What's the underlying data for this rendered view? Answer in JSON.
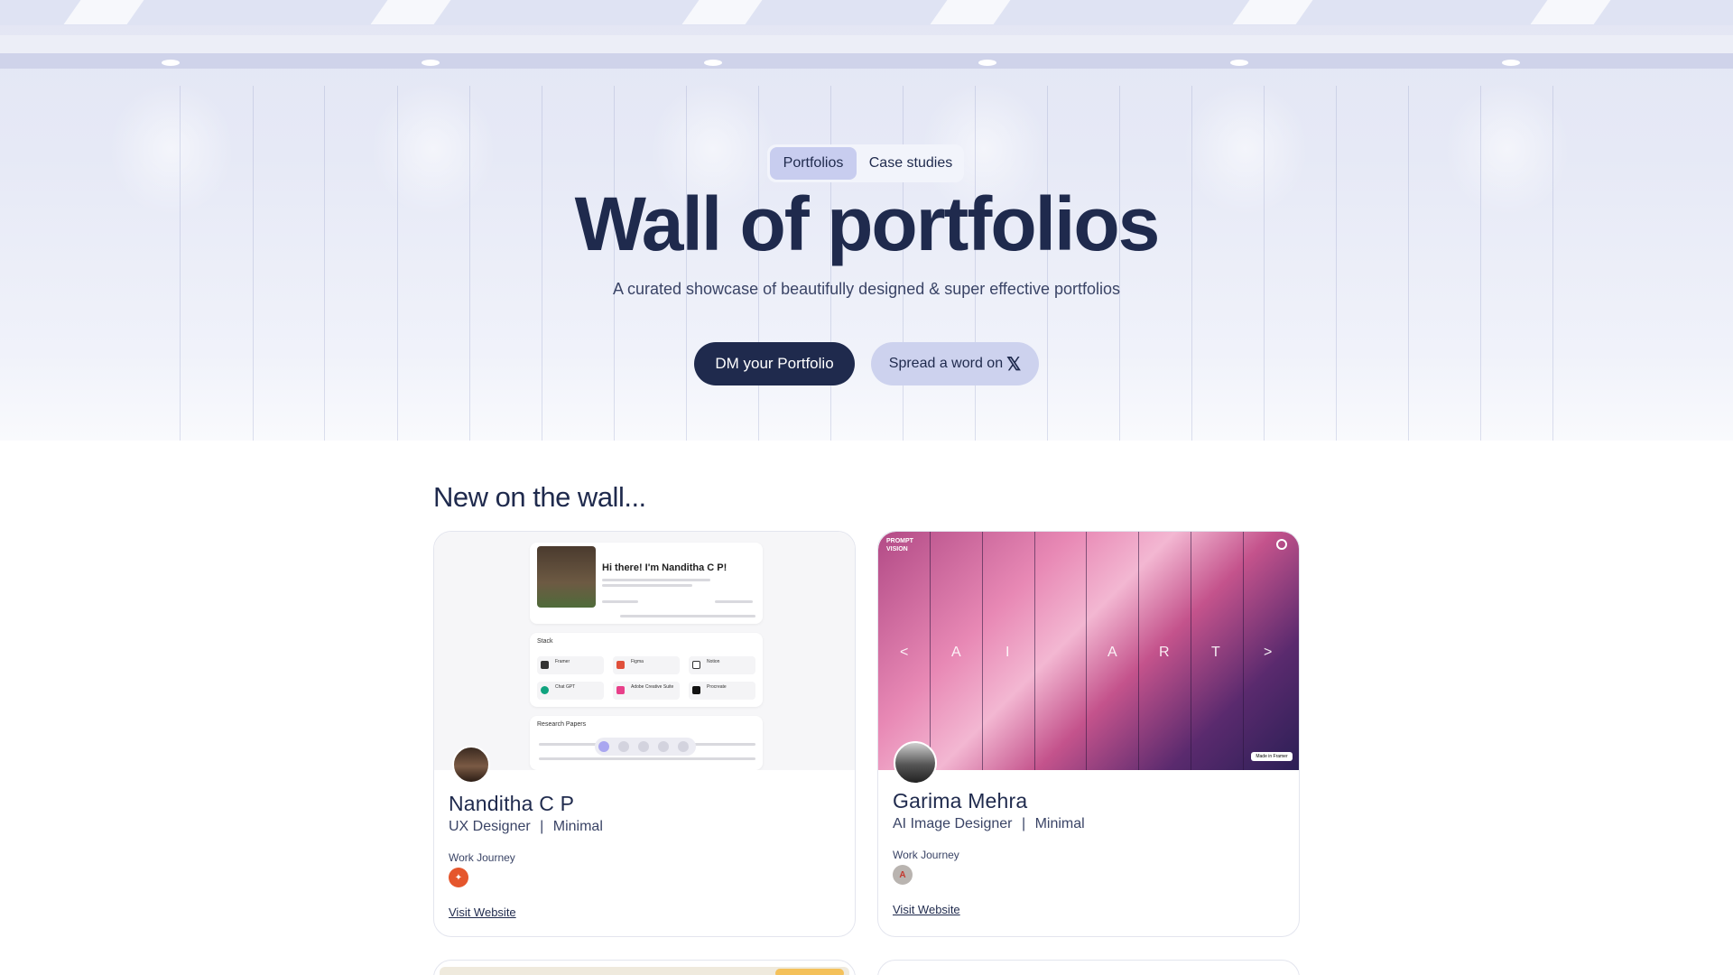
{
  "hero": {
    "tabs": [
      {
        "label": "Portfolios",
        "active": true
      },
      {
        "label": "Case studies",
        "active": false
      }
    ],
    "title": "Wall of portfolios",
    "subtitle": "A curated showcase of beautifully designed & super effective portfolios",
    "primary_button": "DM your Portfolio",
    "secondary_button": "Spread a word on",
    "secondary_icon": "𝕏"
  },
  "section": {
    "title": "New on the wall..."
  },
  "cards": [
    {
      "name": "Nanditha C P",
      "role": "UX Designer",
      "style": "Minimal",
      "separator": "|",
      "journey_label": "Work Journey",
      "journey_icon": "company-logo-icon",
      "link": "Visit Website",
      "preview": {
        "greeting": "Hi there! I'm Nanditha C P!",
        "stack_label": "Stack",
        "research_label": "Research Papers",
        "tools": [
          "Framer",
          "Figma",
          "Notion",
          "Chat GPT",
          "Adobe Creative Suite",
          "Procreate"
        ]
      }
    },
    {
      "name": "Garima Mehra",
      "role": "AI Image Designer",
      "style": "Minimal",
      "separator": "|",
      "journey_label": "Work Journey",
      "journey_icon": "company-logo-icon",
      "link": "Visit Website",
      "preview": {
        "brand": "PROMPT VISION",
        "letters": [
          "<",
          "A",
          "I",
          "A",
          "R",
          "T",
          ">"
        ],
        "badge": "Made in Framer"
      }
    }
  ],
  "colors": {
    "navy": "#1f2a4d",
    "accent_lavender": "#c8cdef",
    "hero_bg": "#e3e6f4"
  }
}
